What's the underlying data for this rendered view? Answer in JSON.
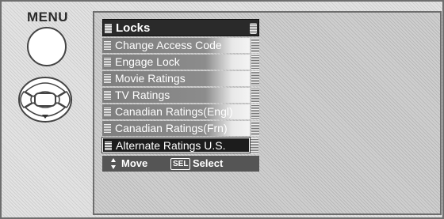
{
  "remote": {
    "menu_label": "MENU"
  },
  "osd": {
    "title": "Locks",
    "items": [
      {
        "label": "Change Access Code"
      },
      {
        "label": "Engage Lock"
      },
      {
        "label": "Movie Ratings"
      },
      {
        "label": "TV Ratings"
      },
      {
        "label": "Canadian Ratings(Engl)"
      },
      {
        "label": "Canadian Ratings(Frn)"
      },
      {
        "label": "Alternate Ratings U.S."
      }
    ],
    "selected_index": 6,
    "help": {
      "move_label": "Move",
      "sel_key": "SEL",
      "select_label": "Select"
    }
  }
}
